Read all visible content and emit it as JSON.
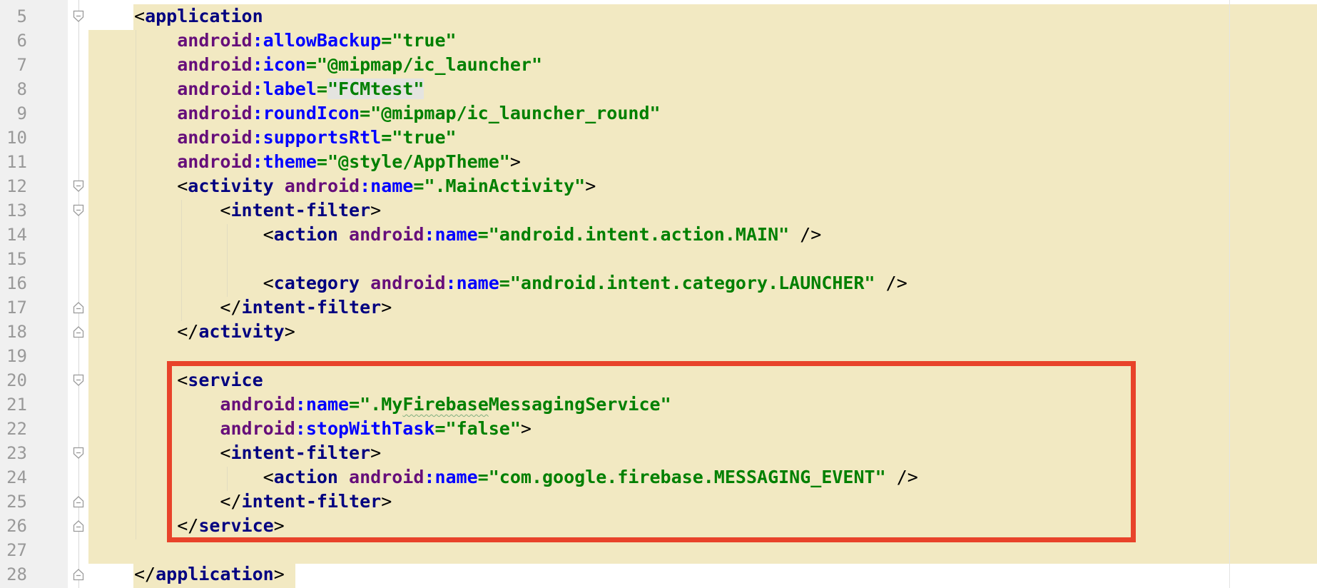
{
  "editor": {
    "lines": [
      {
        "num": "5",
        "fold": "open",
        "tokens": [
          {
            "t": "<",
            "c": "p"
          },
          {
            "t": "application",
            "c": "tag"
          }
        ]
      },
      {
        "num": "6",
        "fold": "",
        "tokens": [
          {
            "t": "    ",
            "c": "p"
          },
          {
            "t": "android",
            "c": "ns"
          },
          {
            "t": ":",
            "c": "attr"
          },
          {
            "t": "allowBackup",
            "c": "attr"
          },
          {
            "t": "=",
            "c": "val"
          },
          {
            "t": "\"true\"",
            "c": "val"
          }
        ]
      },
      {
        "num": "7",
        "fold": "",
        "tokens": [
          {
            "t": "    ",
            "c": "p"
          },
          {
            "t": "android",
            "c": "ns"
          },
          {
            "t": ":",
            "c": "attr"
          },
          {
            "t": "icon",
            "c": "attr"
          },
          {
            "t": "=",
            "c": "val"
          },
          {
            "t": "\"@mipmap/ic_launcher\"",
            "c": "val"
          }
        ]
      },
      {
        "num": "8",
        "fold": "",
        "tokens": [
          {
            "t": "    ",
            "c": "p"
          },
          {
            "t": "android",
            "c": "ns"
          },
          {
            "t": ":",
            "c": "attr"
          },
          {
            "t": "label",
            "c": "attr"
          },
          {
            "t": "=",
            "c": "val"
          },
          {
            "t": "\"FCMtest\"",
            "c": "val valhl"
          }
        ]
      },
      {
        "num": "9",
        "fold": "",
        "tokens": [
          {
            "t": "    ",
            "c": "p"
          },
          {
            "t": "android",
            "c": "ns"
          },
          {
            "t": ":",
            "c": "attr"
          },
          {
            "t": "roundIcon",
            "c": "attr"
          },
          {
            "t": "=",
            "c": "val"
          },
          {
            "t": "\"@mipmap/ic_launcher_round\"",
            "c": "val"
          }
        ]
      },
      {
        "num": "10",
        "fold": "",
        "tokens": [
          {
            "t": "    ",
            "c": "p"
          },
          {
            "t": "android",
            "c": "ns"
          },
          {
            "t": ":",
            "c": "attr"
          },
          {
            "t": "supportsRtl",
            "c": "attr"
          },
          {
            "t": "=",
            "c": "val"
          },
          {
            "t": "\"true\"",
            "c": "val"
          }
        ]
      },
      {
        "num": "11",
        "fold": "",
        "tokens": [
          {
            "t": "    ",
            "c": "p"
          },
          {
            "t": "android",
            "c": "ns"
          },
          {
            "t": ":",
            "c": "attr"
          },
          {
            "t": "theme",
            "c": "attr"
          },
          {
            "t": "=",
            "c": "val"
          },
          {
            "t": "\"@style/AppTheme\"",
            "c": "val"
          },
          {
            "t": ">",
            "c": "p"
          }
        ]
      },
      {
        "num": "12",
        "fold": "open",
        "tokens": [
          {
            "t": "    <",
            "c": "p"
          },
          {
            "t": "activity ",
            "c": "tag"
          },
          {
            "t": "android",
            "c": "ns"
          },
          {
            "t": ":",
            "c": "attr"
          },
          {
            "t": "name",
            "c": "attr"
          },
          {
            "t": "=",
            "c": "val"
          },
          {
            "t": "\".MainActivity\"",
            "c": "val"
          },
          {
            "t": ">",
            "c": "p"
          }
        ]
      },
      {
        "num": "13",
        "fold": "open",
        "tokens": [
          {
            "t": "        <",
            "c": "p"
          },
          {
            "t": "intent-filter",
            "c": "tag"
          },
          {
            "t": ">",
            "c": "p"
          }
        ]
      },
      {
        "num": "14",
        "fold": "",
        "tokens": [
          {
            "t": "            <",
            "c": "p"
          },
          {
            "t": "action ",
            "c": "tag"
          },
          {
            "t": "android",
            "c": "ns"
          },
          {
            "t": ":",
            "c": "attr"
          },
          {
            "t": "name",
            "c": "attr"
          },
          {
            "t": "=",
            "c": "val"
          },
          {
            "t": "\"android.intent.action.MAIN\"",
            "c": "val"
          },
          {
            "t": " />",
            "c": "p"
          }
        ]
      },
      {
        "num": "15",
        "fold": "",
        "tokens": []
      },
      {
        "num": "16",
        "fold": "",
        "tokens": [
          {
            "t": "            <",
            "c": "p"
          },
          {
            "t": "category ",
            "c": "tag"
          },
          {
            "t": "android",
            "c": "ns"
          },
          {
            "t": ":",
            "c": "attr"
          },
          {
            "t": "name",
            "c": "attr"
          },
          {
            "t": "=",
            "c": "val"
          },
          {
            "t": "\"android.intent.category.LAUNCHER\"",
            "c": "val"
          },
          {
            "t": " />",
            "c": "p"
          }
        ]
      },
      {
        "num": "17",
        "fold": "close",
        "tokens": [
          {
            "t": "        </",
            "c": "p"
          },
          {
            "t": "intent-filter",
            "c": "tag"
          },
          {
            "t": ">",
            "c": "p"
          }
        ]
      },
      {
        "num": "18",
        "fold": "close",
        "tokens": [
          {
            "t": "    </",
            "c": "p"
          },
          {
            "t": "activity",
            "c": "tag"
          },
          {
            "t": ">",
            "c": "p"
          }
        ]
      },
      {
        "num": "19",
        "fold": "",
        "tokens": []
      },
      {
        "num": "20",
        "fold": "open",
        "tokens": [
          {
            "t": "    <",
            "c": "p"
          },
          {
            "t": "service",
            "c": "tag"
          }
        ]
      },
      {
        "num": "21",
        "fold": "",
        "tokens": [
          {
            "t": "        ",
            "c": "p"
          },
          {
            "t": "android",
            "c": "ns"
          },
          {
            "t": ":",
            "c": "attr"
          },
          {
            "t": "name",
            "c": "attr"
          },
          {
            "t": "=",
            "c": "val"
          },
          {
            "t": "\".My",
            "c": "val"
          },
          {
            "t": "Firebase",
            "c": "val typo"
          },
          {
            "t": "MessagingService\"",
            "c": "val"
          }
        ]
      },
      {
        "num": "22",
        "fold": "",
        "tokens": [
          {
            "t": "        ",
            "c": "p"
          },
          {
            "t": "android",
            "c": "ns"
          },
          {
            "t": ":",
            "c": "attr"
          },
          {
            "t": "stopWithTask",
            "c": "attr"
          },
          {
            "t": "=",
            "c": "val"
          },
          {
            "t": "\"false\"",
            "c": "val"
          },
          {
            "t": ">",
            "c": "p"
          }
        ]
      },
      {
        "num": "23",
        "fold": "open",
        "tokens": [
          {
            "t": "        <",
            "c": "p"
          },
          {
            "t": "intent-filter",
            "c": "tag"
          },
          {
            "t": ">",
            "c": "p"
          }
        ]
      },
      {
        "num": "24",
        "fold": "",
        "tokens": [
          {
            "t": "            <",
            "c": "p"
          },
          {
            "t": "action ",
            "c": "tag"
          },
          {
            "t": "android",
            "c": "ns"
          },
          {
            "t": ":",
            "c": "attr"
          },
          {
            "t": "name",
            "c": "attr"
          },
          {
            "t": "=",
            "c": "val"
          },
          {
            "t": "\"com.google.firebase.MESSAGING_EVENT\"",
            "c": "val"
          },
          {
            "t": " />",
            "c": "p"
          }
        ]
      },
      {
        "num": "25",
        "fold": "close",
        "tokens": [
          {
            "t": "        </",
            "c": "p"
          },
          {
            "t": "intent-filter",
            "c": "tag"
          },
          {
            "t": ">",
            "c": "p"
          }
        ]
      },
      {
        "num": "26",
        "fold": "close",
        "tokens": [
          {
            "t": "    </",
            "c": "p"
          },
          {
            "t": "service",
            "c": "tag"
          },
          {
            "t": ">",
            "c": "p"
          }
        ]
      },
      {
        "num": "27",
        "fold": "",
        "tokens": []
      },
      {
        "num": "28",
        "fold": "close",
        "tokens": [
          {
            "t": "</",
            "c": "p"
          },
          {
            "t": "application",
            "c": "tag"
          },
          {
            "t": ">",
            "c": "p"
          }
        ]
      }
    ]
  },
  "colors": {
    "highlight_background": "#f2e9c2",
    "annotation_box": "#e8432a",
    "tag": "#000080",
    "namespace": "#660e7a",
    "attribute": "#0000ff",
    "value": "#008000",
    "line_number": "#999999"
  }
}
